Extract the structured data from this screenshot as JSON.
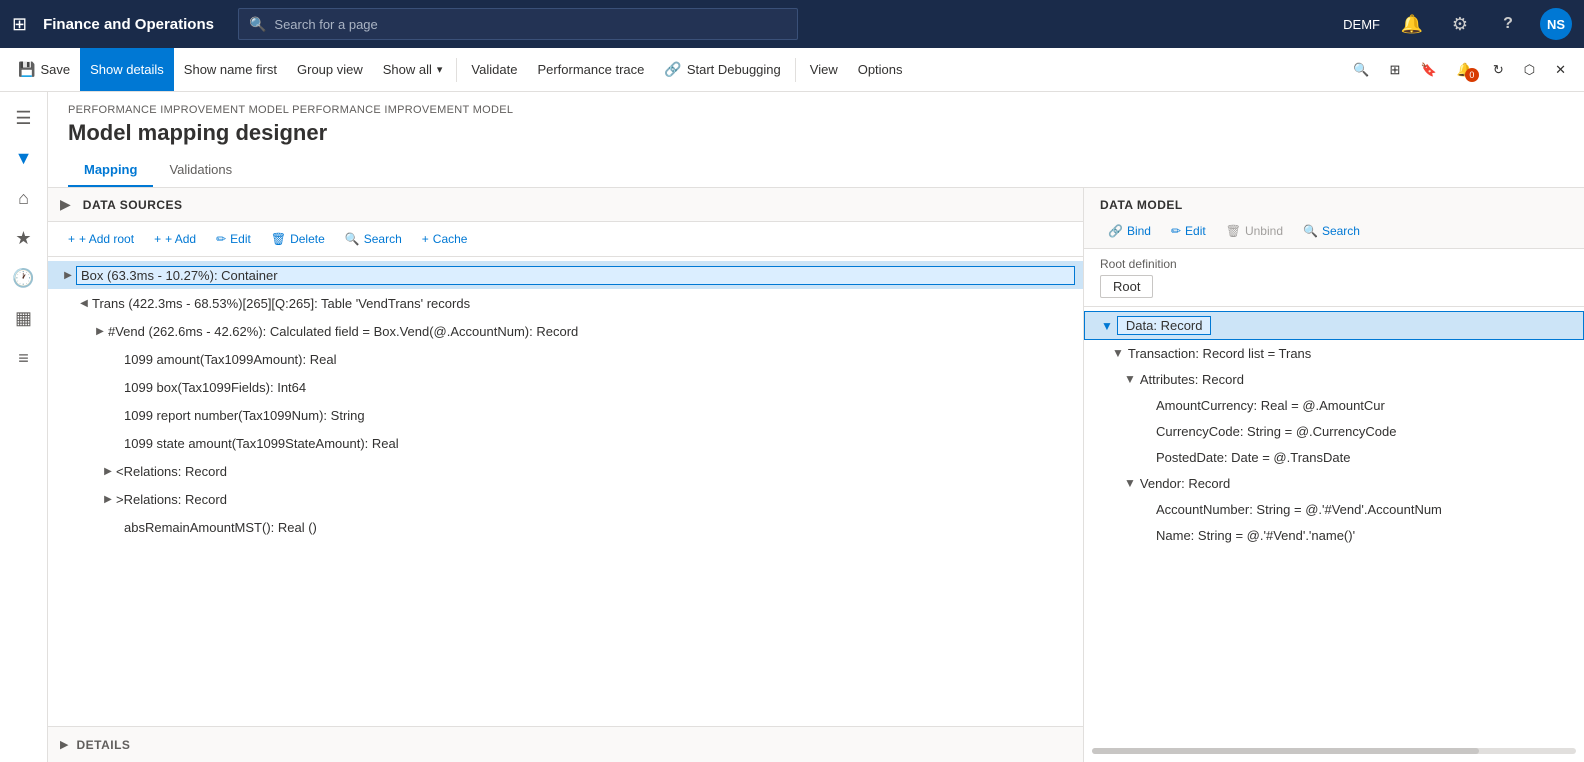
{
  "app": {
    "title": "Finance and Operations",
    "search_placeholder": "Search for a page",
    "env": "DEMF",
    "avatar": "NS"
  },
  "command_bar": {
    "save": "Save",
    "show_details": "Show details",
    "show_name_first": "Show name first",
    "group_view": "Group view",
    "show_all": "Show all",
    "validate": "Validate",
    "performance_trace": "Performance trace",
    "start_debugging": "Start Debugging",
    "view": "View",
    "options": "Options"
  },
  "breadcrumb": "PERFORMANCE IMPROVEMENT MODEL PERFORMANCE IMPROVEMENT MODEL",
  "page_title": "Model mapping designer",
  "tabs": {
    "mapping": "Mapping",
    "validations": "Validations"
  },
  "left_panel": {
    "title": "DATA SOURCES",
    "toolbar": {
      "add_root": "+ Add root",
      "add": "+ Add",
      "edit": "Edit",
      "delete": "Delete",
      "search": "Search",
      "cache": "Cache"
    },
    "tree": [
      {
        "id": "box",
        "label": "Box (63.3ms - 10.27%): Container",
        "indent": 0,
        "expanded": false,
        "selected": true,
        "expander": "▶"
      },
      {
        "id": "trans",
        "label": "Trans (422.3ms - 68.53%)[265][Q:265]: Table 'VendTrans' records",
        "indent": 1,
        "expanded": true,
        "expander": "◀"
      },
      {
        "id": "vend",
        "label": "#Vend (262.6ms - 42.62%): Calculated field = Box.Vend(@.AccountNum): Record",
        "indent": 2,
        "expanded": false,
        "expander": "▶"
      },
      {
        "id": "amt1099",
        "label": "1099 amount(Tax1099Amount): Real",
        "indent": 3,
        "expanded": false
      },
      {
        "id": "box1099",
        "label": "1099 box(Tax1099Fields): Int64",
        "indent": 3,
        "expanded": false
      },
      {
        "id": "report1099",
        "label": "1099 report number(Tax1099Num): String",
        "indent": 3,
        "expanded": false
      },
      {
        "id": "state1099",
        "label": "1099 state amount(Tax1099StateAmount): Real",
        "indent": 3,
        "expanded": false
      },
      {
        "id": "rel1",
        "label": "<Relations: Record",
        "indent": 3,
        "expanded": false,
        "expander": "▶"
      },
      {
        "id": "rel2",
        "label": ">Relations: Record",
        "indent": 3,
        "expanded": false,
        "expander": "▶"
      },
      {
        "id": "abs",
        "label": "absRemainAmountMST(): Real ()",
        "indent": 3,
        "expanded": false
      }
    ]
  },
  "right_panel": {
    "title": "DATA MODEL",
    "toolbar": {
      "bind": "Bind",
      "edit": "Edit",
      "unbind": "Unbind",
      "search": "Search"
    },
    "root_definition_label": "Root definition",
    "root_definition_value": "Root",
    "tree": [
      {
        "id": "data",
        "label": "Data: Record",
        "indent": 0,
        "expanded": true,
        "selected": true,
        "expander": "▼"
      },
      {
        "id": "transaction",
        "label": "Transaction: Record list = Trans",
        "indent": 1,
        "expanded": true,
        "expander": "▼"
      },
      {
        "id": "attributes",
        "label": "Attributes: Record",
        "indent": 2,
        "expanded": true,
        "expander": "▼"
      },
      {
        "id": "amount_currency",
        "label": "AmountCurrency: Real = @.AmountCur",
        "indent": 3
      },
      {
        "id": "currency_code",
        "label": "CurrencyCode: String = @.CurrencyCode",
        "indent": 3
      },
      {
        "id": "posted_date",
        "label": "PostedDate: Date = @.TransDate",
        "indent": 3
      },
      {
        "id": "vendor",
        "label": "Vendor: Record",
        "indent": 2,
        "expanded": true,
        "expander": "▼"
      },
      {
        "id": "account_number",
        "label": "AccountNumber: String = @.'#Vend'.AccountNum",
        "indent": 3
      },
      {
        "id": "name",
        "label": "Name: String = @.'#Vend'.'name()'",
        "indent": 3
      }
    ]
  },
  "bottom_panel": {
    "title": "DETAILS"
  },
  "icons": {
    "grid": "⊞",
    "search": "🔍",
    "save": "💾",
    "filter": "▼",
    "home": "⌂",
    "star": "★",
    "clock": "🕐",
    "table": "▦",
    "list": "≡",
    "bell": "🔔",
    "gear": "⚙",
    "help": "?",
    "pin": "📌",
    "bookmark": "🔖",
    "notification": "0",
    "refresh": "↻",
    "open_new": "⬡",
    "close": "✕",
    "link": "🔗",
    "pencil": "✏",
    "trash": "🗑",
    "plus": "+",
    "cache": "+"
  }
}
